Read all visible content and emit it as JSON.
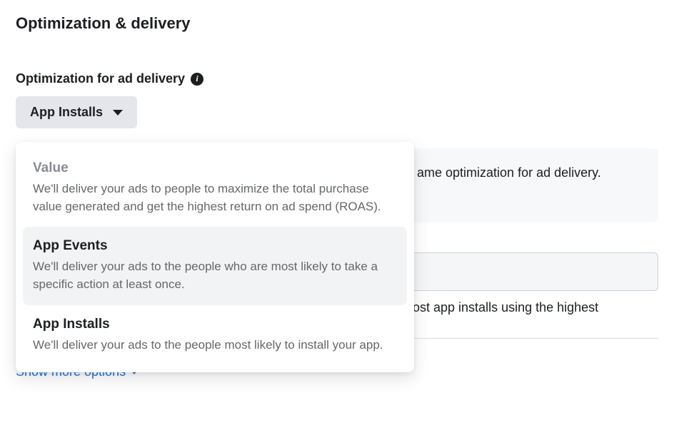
{
  "section_title": "Optimization & delivery",
  "field_label": "Optimization for ad delivery",
  "dropdown": {
    "selected": "App Installs",
    "options": [
      {
        "title": "Value",
        "desc": "We'll deliver your ads to people to maximize the total purchase value generated and get the highest return on ad spend (ROAS).",
        "disabled": true,
        "highlighted": false
      },
      {
        "title": "App Events",
        "desc": "We'll deliver your ads to the people who are most likely to take a specific action at least once.",
        "disabled": false,
        "highlighted": true
      },
      {
        "title": "App Installs",
        "desc": "We'll deliver your ads to the people most likely to install your app.",
        "disabled": false,
        "highlighted": false
      }
    ]
  },
  "info_box_text": "ame optimization for ad delivery.",
  "helper_text": "ost app installs using the highest",
  "show_more_label": "Show more options"
}
